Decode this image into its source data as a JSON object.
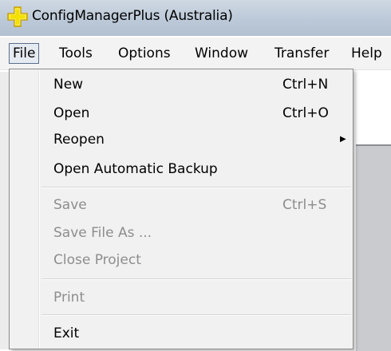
{
  "window": {
    "title": "ConfigManagerPlus (Australia)",
    "app_icon": "yellow-plus-icon"
  },
  "menubar": {
    "items": [
      "File",
      "Tools",
      "Options",
      "Window",
      "Transfer",
      "Help"
    ],
    "active": "File"
  },
  "file_menu": {
    "items": [
      {
        "label": "New",
        "shortcut": "Ctrl+N",
        "enabled": true
      },
      {
        "label": "Open",
        "shortcut": "Ctrl+O",
        "enabled": true
      },
      {
        "label": "Reopen",
        "submenu_arrow": "▶",
        "enabled": true
      },
      {
        "label": "Open Automatic Backup",
        "enabled": true
      },
      {
        "label": "Save",
        "shortcut": "Ctrl+S",
        "enabled": false
      },
      {
        "label": "Save File As ...",
        "enabled": false
      },
      {
        "label": "Close Project",
        "enabled": false
      },
      {
        "label": "Print",
        "enabled": false
      },
      {
        "label": "Exit",
        "enabled": true
      }
    ]
  },
  "colors": {
    "titlebar": "#bcc9d8",
    "menubar": "#f3f3f3",
    "dropdown_bg": "#f1f1f1",
    "disabled_text": "#8d8d8d",
    "icon_yellow": "#f4e000",
    "icon_outline": "#c8a000"
  }
}
